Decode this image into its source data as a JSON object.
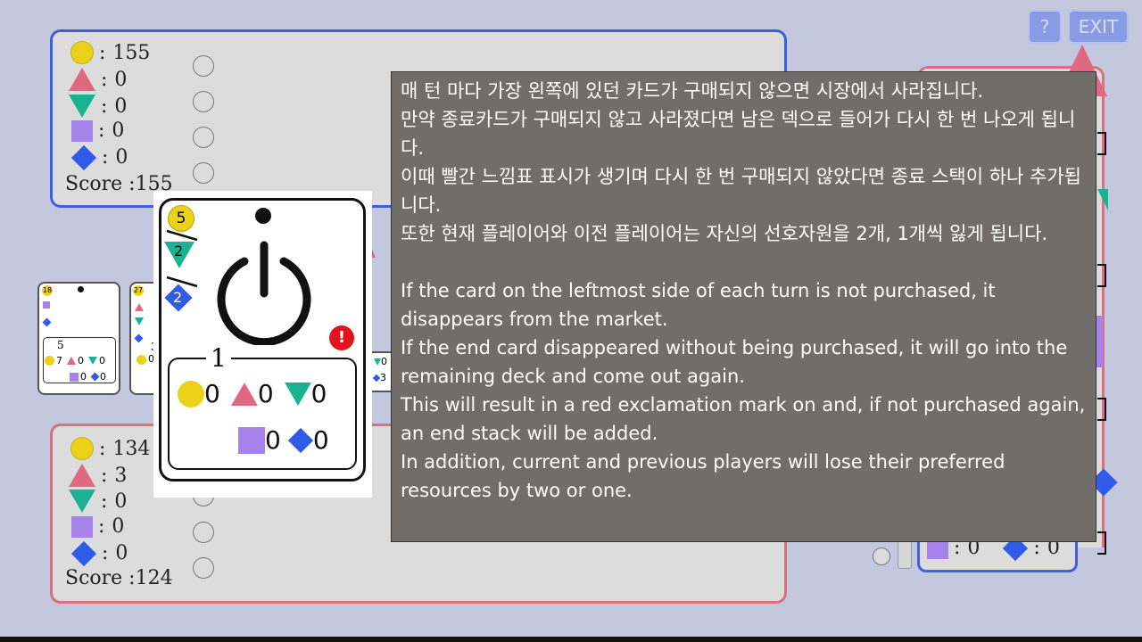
{
  "buttons": {
    "help": "?",
    "exit": "EXIT"
  },
  "player_top": {
    "stats": [
      {
        "icon": "circle-icon",
        "value": "155"
      },
      {
        "icon": "triangle-up-icon",
        "value": "0"
      },
      {
        "icon": "triangle-down-icon",
        "value": "0"
      },
      {
        "icon": "square-icon",
        "value": "0"
      },
      {
        "icon": "diamond-icon",
        "value": "0"
      }
    ],
    "score_label": "Score :155",
    "colors": {
      "border": "#3f5fe0"
    }
  },
  "player_bottom": {
    "stats": [
      {
        "icon": "circle-icon",
        "value": "134"
      },
      {
        "icon": "triangle-up-icon",
        "value": "3"
      },
      {
        "icon": "triangle-down-icon",
        "value": "0"
      },
      {
        "icon": "square-icon",
        "value": "0"
      },
      {
        "icon": "diamond-icon",
        "value": "0"
      }
    ],
    "score_label": "Score :124",
    "colors": {
      "border": "#d9707f"
    }
  },
  "right_panel": {
    "square_value": "0",
    "diamond_value": "0"
  },
  "market": {
    "card1": {
      "cost": "18",
      "tier": "5",
      "circle": "7",
      "up": "0",
      "down": "0",
      "square": "0",
      "diamond": "0"
    },
    "card2": {
      "cost": "27",
      "tier": "3",
      "circle": "0"
    },
    "right_edge": {
      "down": "0",
      "diamond": "3"
    }
  },
  "big_card": {
    "cost": "5",
    "bonus_down": "2",
    "bonus_diamond": "2",
    "tier": "1",
    "alert": "!",
    "circle": "0",
    "up": "0",
    "down": "0",
    "square": "0",
    "diamond": "0"
  },
  "tooltip": {
    "korean": [
      "매 턴 마다 가장 왼쪽에 있던 카드가 구매되지 않으면 시장에서 사라집니다.",
      "만약 종료카드가 구매되지 않고 사라졌다면 남은 덱으로 들어가 다시 한 번 나오게 됩니다.",
      "이때 빨간 느낌표 표시가 생기며 다시 한 번 구매되지 않았다면 종료 스택이 하나 추가됩니다.",
      "또한 현재 플레이어와 이전 플레이어는 자신의 선호자원을 2개, 1개씩 잃게 됩니다."
    ],
    "english": [
      "If the card on the leftmost side of each turn is not purchased, it disappears from the market.",
      "If the end card disappeared without being purchased, it will go into the remaining deck and come out again.",
      "This will result in a red exclamation mark on and, if not purchased again, an end stack will be added.",
      "In addition, current and previous players will lose their preferred resources by two or one."
    ]
  },
  "colors": {
    "background": "#c3c8de",
    "tooltip_bg": "#716d6b",
    "circle": "#ead21a",
    "triangle_up": "#e06880",
    "triangle_down": "#1ab391",
    "square": "#a583ea",
    "diamond": "#2f5be8",
    "alert": "#e0141c"
  }
}
